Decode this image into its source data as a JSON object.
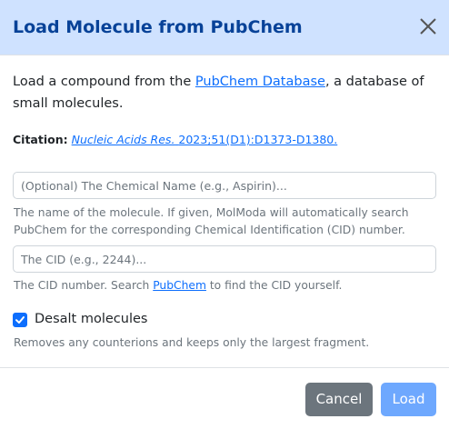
{
  "dialog": {
    "title": "Load Molecule from PubChem",
    "close_label": "×"
  },
  "intro": {
    "text_before": "Load a compound from the ",
    "link_text": "PubChem Database",
    "text_after": ", a database of small molecules."
  },
  "citation": {
    "label": "Citation:",
    "journal": "Nucleic Acids Res.",
    "reference": "2023;51(D1):D1373-D1380."
  },
  "name_field": {
    "value": "",
    "placeholder": "(Optional) The Chemical Name (e.g., Aspirin)...",
    "help": "The name of the molecule. If given, MolModa will automatically search PubChem for the corresponding Chemical Identification (CID) number."
  },
  "cid_field": {
    "value": "",
    "placeholder": "The CID (e.g., 2244)...",
    "help_before": "The CID number. Search ",
    "help_link": "PubChem",
    "help_after": " to find the CID yourself."
  },
  "desalt": {
    "checked": true,
    "label": "Desalt molecules",
    "help": "Removes any counterions and keeps only the largest fragment."
  },
  "buttons": {
    "cancel": "Cancel",
    "load": "Load"
  },
  "colors": {
    "header_bg": "#cfe2ff",
    "title": "#084298",
    "link": "#0d6efd",
    "cancel_bg": "#6c757d",
    "load_bg": "#6ea8fe",
    "checkbox": "#0d6efd"
  }
}
